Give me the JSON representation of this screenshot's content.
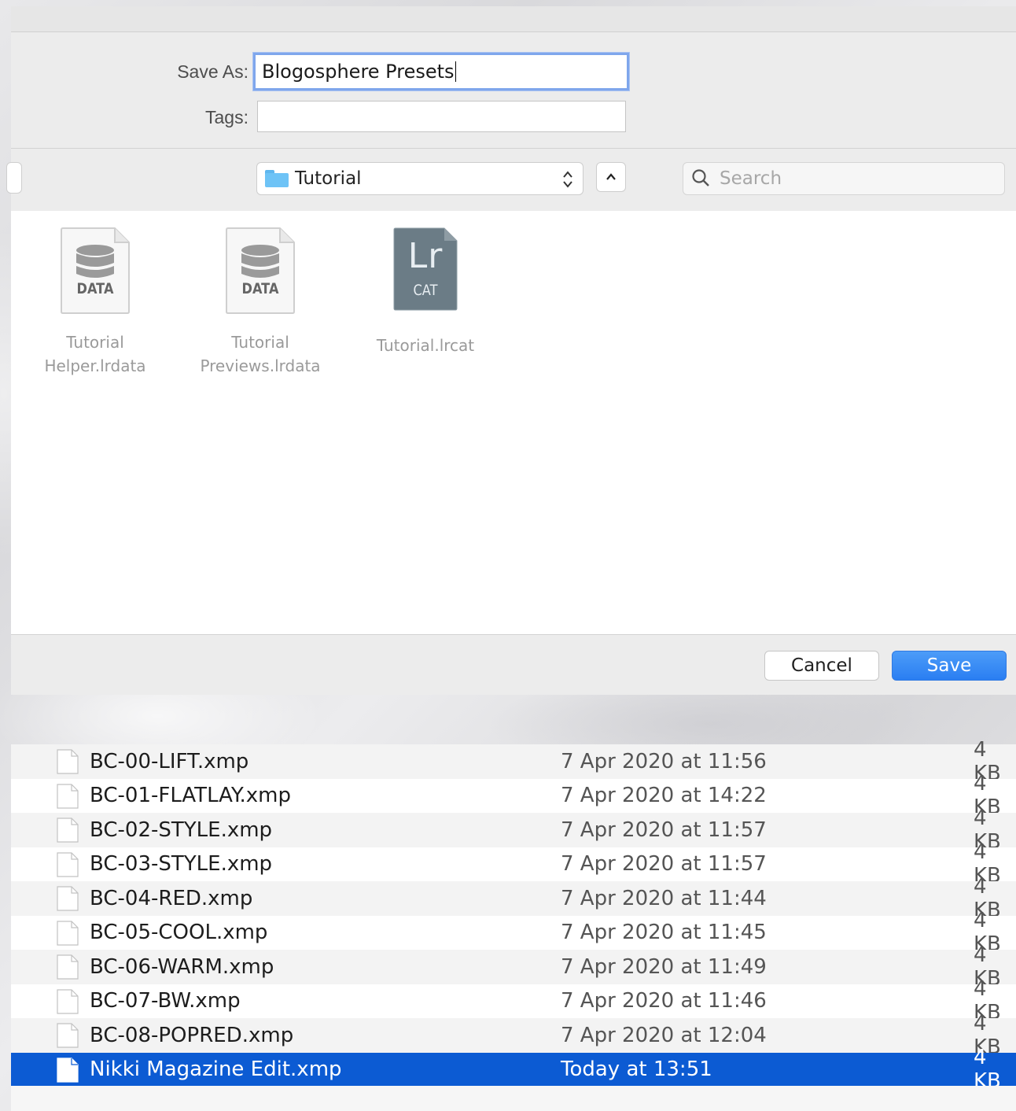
{
  "dialog": {
    "save_as_label": "Save As:",
    "save_as_value": "Blogosphere Presets",
    "tags_label": "Tags:",
    "tags_value": "",
    "location": "Tutorial",
    "search_placeholder": "Search",
    "cancel_label": "Cancel",
    "save_label": "Save",
    "files": [
      {
        "name": "Tutorial Helper.lrdata",
        "line1": "Tutorial",
        "line2": "Helper.lrdata",
        "icon": "database-document-icon",
        "caption": "DATA"
      },
      {
        "name": "Tutorial Previews.lrdata",
        "line1": "Tutorial",
        "line2": "Previews.lrdata",
        "icon": "database-document-icon",
        "caption": "DATA"
      },
      {
        "name": "Tutorial.lrcat",
        "line1": "Tutorial.lrcat",
        "line2": "",
        "icon": "lightroom-catalog-icon",
        "caption": "CAT",
        "badge": "Lr"
      }
    ]
  },
  "file_list": {
    "rows": [
      {
        "name": "BC-00-LIFT.xmp",
        "date": "7 Apr 2020 at 11:56",
        "size": "4 KB"
      },
      {
        "name": "BC-01-FLATLAY.xmp",
        "date": "7 Apr 2020 at 14:22",
        "size": "4 KB"
      },
      {
        "name": "BC-02-STYLE.xmp",
        "date": "7 Apr 2020 at 11:57",
        "size": "4 KB"
      },
      {
        "name": "BC-03-STYLE.xmp",
        "date": "7 Apr 2020 at 11:57",
        "size": "4 KB"
      },
      {
        "name": "BC-04-RED.xmp",
        "date": "7 Apr 2020 at 11:44",
        "size": "4 KB"
      },
      {
        "name": "BC-05-COOL.xmp",
        "date": "7 Apr 2020 at 11:45",
        "size": "4 KB"
      },
      {
        "name": "BC-06-WARM.xmp",
        "date": "7 Apr 2020 at 11:49",
        "size": "4 KB"
      },
      {
        "name": "BC-07-BW.xmp",
        "date": "7 Apr 2020 at 11:46",
        "size": "4 KB"
      },
      {
        "name": "BC-08-POPRED.xmp",
        "date": "7 Apr 2020 at 12:04",
        "size": "4 KB"
      },
      {
        "name": "Nikki Magazine Edit.xmp",
        "date": "Today at 13:51",
        "size": "4 KB",
        "selected": true
      }
    ]
  },
  "colors": {
    "accent": "#2a7ef2",
    "selection": "#0c5bd3",
    "focus_ring": "#7fa6ec",
    "folder": "#6ec3f6"
  }
}
